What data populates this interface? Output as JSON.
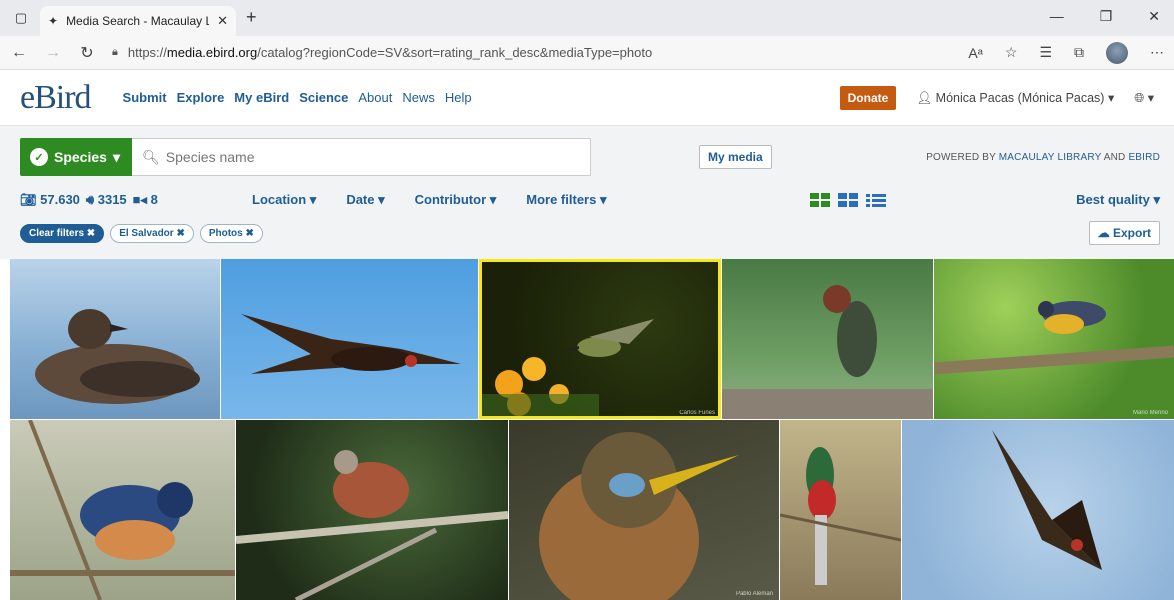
{
  "browser": {
    "tab_title": "Media Search - Macaulay Library",
    "url_prefix": "https://",
    "url_host": "media.ebird.org",
    "url_path": "/catalog?regionCode=SV&sort=rating_rank_desc&mediaType=photo"
  },
  "header": {
    "logo": "eBird",
    "nav": [
      "Submit",
      "Explore",
      "My eBird",
      "Science",
      "About",
      "News",
      "Help"
    ],
    "donate": "Donate",
    "user": "Mónica Pacas (Mónica Pacas)"
  },
  "search": {
    "species_label": "Species",
    "placeholder": "Species name",
    "my_media": "My media",
    "powered_prefix": "POWERED BY",
    "powered_link1": "MACAULAY LIBRARY",
    "powered_and": "AND",
    "powered_link2": "EBIRD"
  },
  "stats": {
    "photos": "57.630",
    "audio": "3315",
    "video": "8"
  },
  "filters": [
    "Location",
    "Date",
    "Contributor",
    "More filters"
  ],
  "sort_label": "Best quality",
  "chips": [
    "Clear filters",
    "El Salvador",
    "Photos"
  ],
  "export": "Export",
  "photos": [
    {
      "subject": "jaeger-on-water",
      "credit": ""
    },
    {
      "subject": "turkey-vulture-flying",
      "credit": ""
    },
    {
      "subject": "hummingbird-at-flowers",
      "credit": "Carlos Funes"
    },
    {
      "subject": "green-heron",
      "credit": ""
    },
    {
      "subject": "yellow-breasted-bird-on-branch",
      "credit": "Mario Merino"
    },
    {
      "subject": "blue-seedeater",
      "credit": ""
    },
    {
      "subject": "ruddy-ground-dove",
      "credit": ""
    },
    {
      "subject": "lesson-s-motmot-chick",
      "credit": "Pablo Aleman"
    },
    {
      "subject": "elegant-trogon",
      "credit": ""
    },
    {
      "subject": "turkey-vulture-soaring",
      "credit": ""
    }
  ],
  "colors": {
    "brand_blue": "#1f5d96",
    "brand_green": "#2e8b22",
    "donate": "#c55a11",
    "selection": "#f5e71c"
  }
}
